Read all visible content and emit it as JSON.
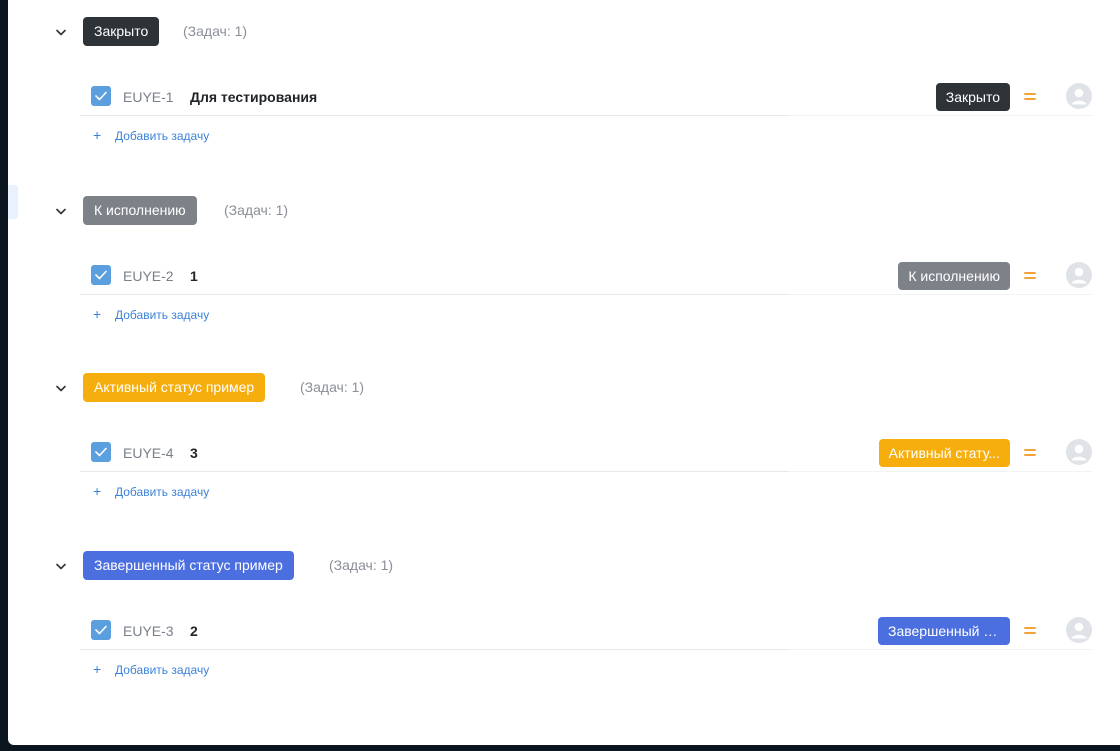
{
  "groups": [
    {
      "label": "Закрыто",
      "count": "(Задач: 1)",
      "color": "#2e3338",
      "task": {
        "key": "EUYE-1",
        "title": "Для тестирования",
        "status": "Закрыто",
        "status_color": "#2e3338"
      },
      "add_label": "Добавить задачу"
    },
    {
      "label": "К исполнению",
      "count": "(Задач: 1)",
      "color": "#7d8289",
      "task": {
        "key": "EUYE-2",
        "title": "1",
        "status": "К исполнению",
        "status_color": "#7d8289"
      },
      "add_label": "Добавить задачу"
    },
    {
      "label": "Активный статус пример",
      "count": "(Задач: 1)",
      "color": "#f6ae0e",
      "task": {
        "key": "EUYE-4",
        "title": "3",
        "status": "Активный стату...",
        "status_color": "#f6ae0e"
      },
      "add_label": "Добавить задачу"
    },
    {
      "label": "Завершенный статус пример",
      "count": "(Задач: 1)",
      "color": "#4c6fe0",
      "task": {
        "key": "EUYE-3",
        "title": "2",
        "status": "Завершенный ст...",
        "status_color": "#4c6fe0"
      },
      "add_label": "Добавить задачу"
    }
  ],
  "icons": {
    "collapse": "chevron-down-icon",
    "check": "checkmark-icon",
    "priority": "priority-medium-icon",
    "assignee": "user-avatar-icon",
    "add": "plus-icon"
  },
  "colors": {
    "priority": "#f6a23a",
    "link": "#3b82d9",
    "checkbox": "#5b9fde"
  }
}
